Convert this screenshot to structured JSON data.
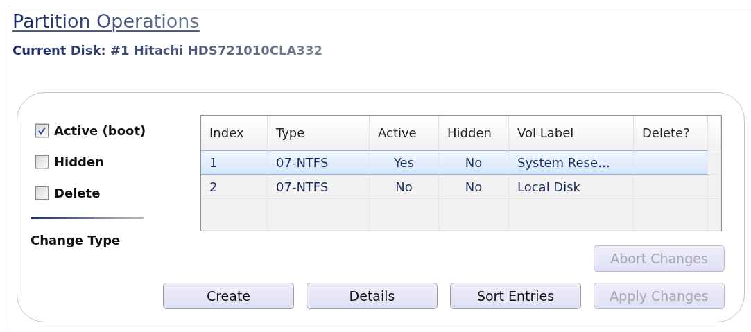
{
  "title": "Partition Operations",
  "current_disk": "Current Disk: #1 Hitachi HDS721010CLA332",
  "options": [
    {
      "label": "Active (boot)",
      "checked": true
    },
    {
      "label": "Hidden",
      "checked": false
    },
    {
      "label": "Delete",
      "checked": false
    }
  ],
  "change_type": "Change Type",
  "table": {
    "columns": [
      "Index",
      "Type",
      "Active",
      "Hidden",
      "Vol Label",
      "Delete?"
    ],
    "rows": [
      {
        "cells": [
          "1",
          "07-NTFS",
          "Yes",
          "No",
          "System Rese…"
        ],
        "selected": true
      },
      {
        "cells": [
          "2",
          "07-NTFS",
          "No",
          "No",
          "Local Disk"
        ],
        "selected": false
      }
    ]
  },
  "side_buttons": [
    {
      "label": "Abort Changes",
      "disabled": true
    }
  ],
  "buttons": [
    {
      "label": "Create",
      "disabled": false
    },
    {
      "label": "Details",
      "disabled": false
    },
    {
      "label": "Sort Entries",
      "disabled": false
    },
    {
      "label": "Apply Changes",
      "disabled": true
    }
  ]
}
